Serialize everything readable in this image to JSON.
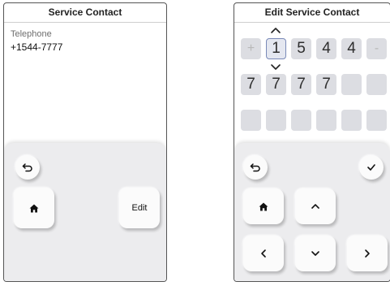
{
  "left_screen": {
    "title": "Service Contact",
    "field_label": "Telephone",
    "field_value": "+1544-7777",
    "edit_label": "Edit"
  },
  "right_screen": {
    "title": "Edit Service Contact",
    "cells": [
      "+",
      "1",
      "5",
      "4",
      "4",
      "-",
      "7",
      "7",
      "7",
      "7",
      "",
      "",
      "",
      "",
      "",
      "",
      "",
      ""
    ],
    "selected_index": 1
  },
  "icons": {
    "back": "back-arrow-icon",
    "home": "home-icon",
    "confirm": "checkmark-icon",
    "up": "chevron-up-icon",
    "down": "chevron-down-icon",
    "left": "chevron-left-icon",
    "right": "chevron-right-icon"
  }
}
